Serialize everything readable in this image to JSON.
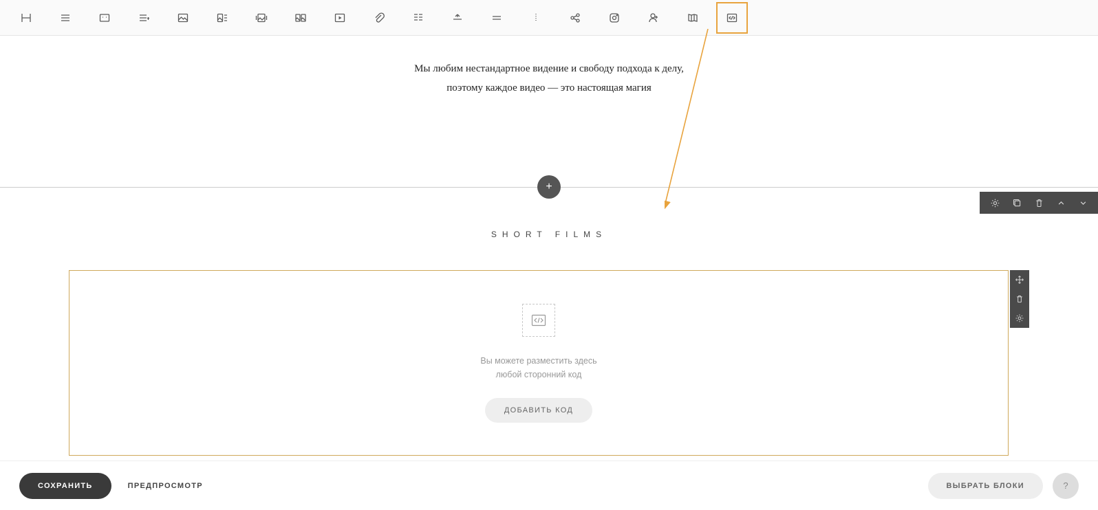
{
  "intro": {
    "line1": "Мы любим нестандартное видение и свободу подхода к делу,",
    "line2": "поэтому каждое видео — это настоящая магия"
  },
  "section_title": "SHORT FILMS",
  "embed": {
    "line1": "Вы можете разместить здесь",
    "line2": "любой сторонний код",
    "button": "ДОБАВИТЬ КОД"
  },
  "bottom": {
    "save": "СОХРАНИТЬ",
    "preview": "ПРЕДПРОСМОТР",
    "choose": "ВЫБРАТЬ БЛОКИ",
    "help": "?"
  }
}
